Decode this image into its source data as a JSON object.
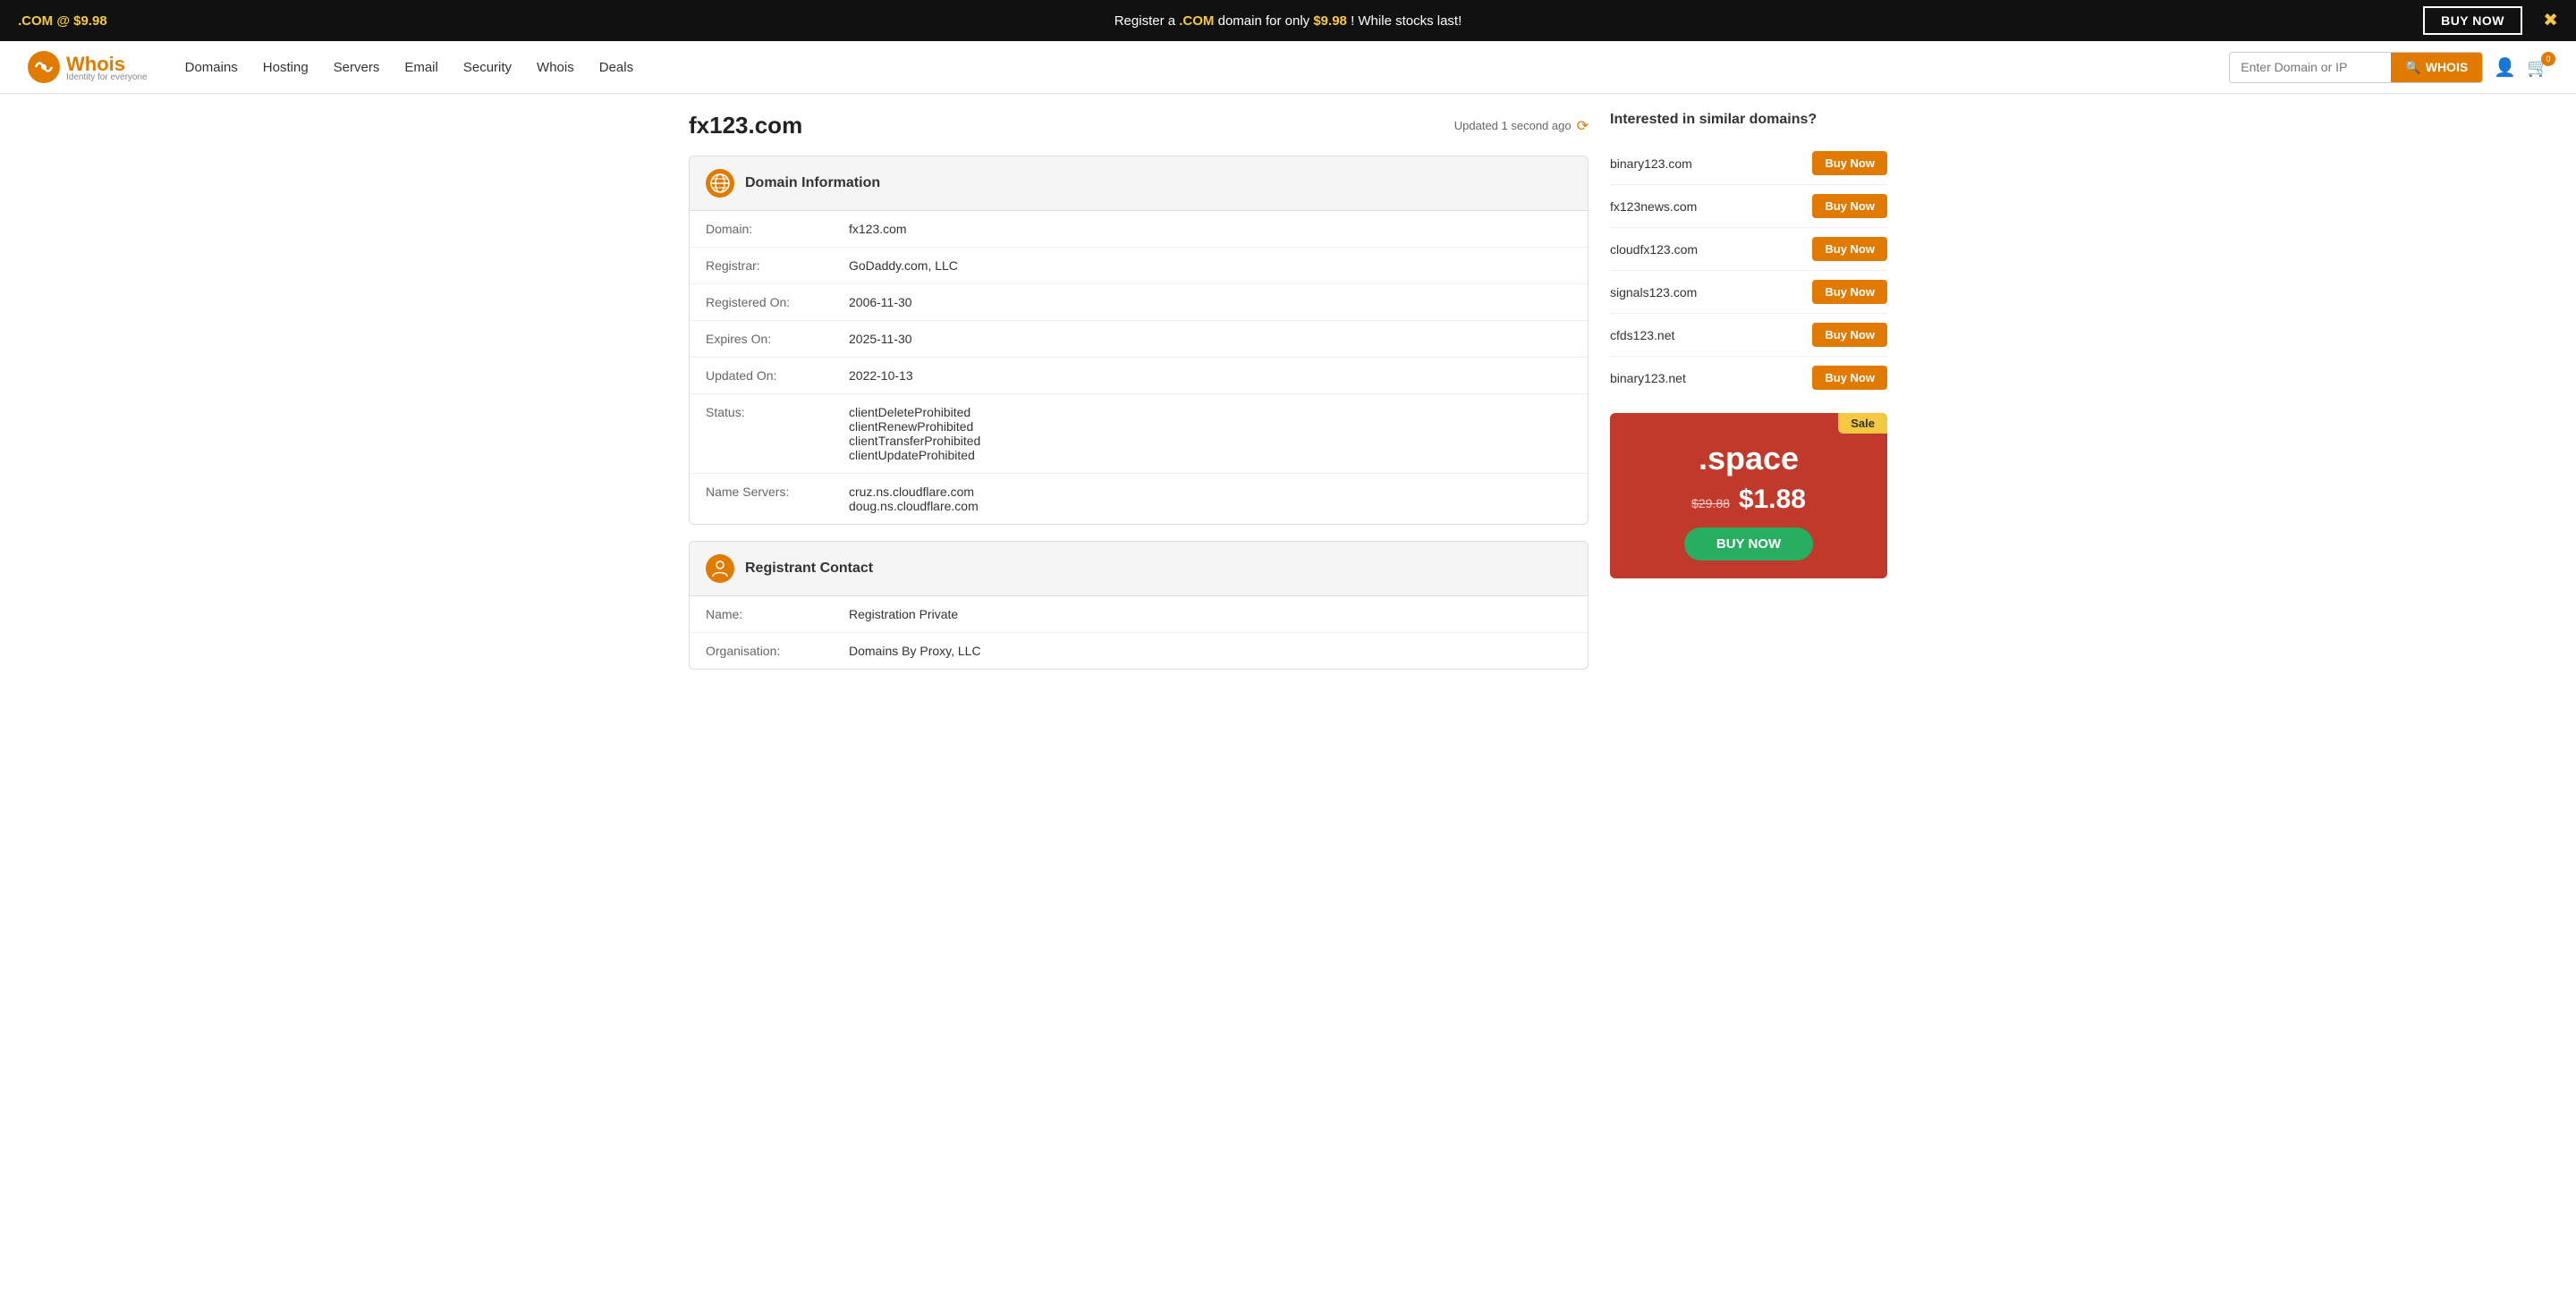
{
  "banner": {
    "left_text": ".COM @ $9.98",
    "center_text": "Register a ",
    "center_highlight": ".COM",
    "center_after": " domain for only ",
    "price_highlight": "$9.98",
    "center_end": "! While stocks last!",
    "buy_now_label": "BUY NOW"
  },
  "header": {
    "logo_text": "Whois",
    "logo_tagline": "Identity for everyone",
    "nav": [
      {
        "label": "Domains",
        "href": "#"
      },
      {
        "label": "Hosting",
        "href": "#"
      },
      {
        "label": "Servers",
        "href": "#"
      },
      {
        "label": "Email",
        "href": "#"
      },
      {
        "label": "Security",
        "href": "#"
      },
      {
        "label": "Whois",
        "href": "#"
      },
      {
        "label": "Deals",
        "href": "#"
      }
    ],
    "search_placeholder": "Enter Domain or IP",
    "search_button_label": "WHOIS",
    "cart_count": "0"
  },
  "domain": {
    "title": "fx123.com",
    "updated_text": "Updated 1 second ago"
  },
  "domain_info": {
    "section_title": "Domain Information",
    "rows": [
      {
        "label": "Domain:",
        "value": "fx123.com"
      },
      {
        "label": "Registrar:",
        "value": "GoDaddy.com, LLC"
      },
      {
        "label": "Registered On:",
        "value": "2006-11-30"
      },
      {
        "label": "Expires On:",
        "value": "2025-11-30"
      },
      {
        "label": "Updated On:",
        "value": "2022-10-13"
      },
      {
        "label": "Status:",
        "value": "clientDeleteProhibited\nclientRenewProhibited\nclientTransferProhibited\nclientUpdateProhibited"
      },
      {
        "label": "Name Servers:",
        "value": "cruz.ns.cloudflare.com\ndoug.ns.cloudflare.com"
      }
    ]
  },
  "registrant": {
    "section_title": "Registrant Contact",
    "rows": [
      {
        "label": "Name:",
        "value": "Registration Private"
      },
      {
        "label": "Organisation:",
        "value": "Domains By Proxy, LLC"
      }
    ]
  },
  "similar_domains": {
    "title": "Interested in similar domains?",
    "items": [
      {
        "name": "binary123.com",
        "button": "Buy Now"
      },
      {
        "name": "fx123news.com",
        "button": "Buy Now"
      },
      {
        "name": "cloudfx123.com",
        "button": "Buy Now"
      },
      {
        "name": "signals123.com",
        "button": "Buy Now"
      },
      {
        "name": "cfds123.net",
        "button": "Buy Now"
      },
      {
        "name": "binary123.net",
        "button": "Buy Now"
      }
    ]
  },
  "sale_card": {
    "badge": "Sale",
    "extension": ".space",
    "old_price": "$29.88",
    "new_price": "$1.88",
    "buy_label": "BUY NOW"
  }
}
